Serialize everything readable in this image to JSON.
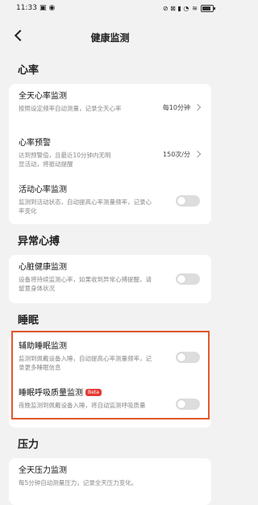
{
  "status": {
    "time": "11:33",
    "right_icons": "⊘ ⊠ ▮ ◔"
  },
  "header": {
    "title": "健康监测"
  },
  "sections": {
    "heart_rate": {
      "title": "心率",
      "all_day": {
        "title": "全天心率监测",
        "sub": "按照设定频率自动测量，记录全天心率",
        "value": "每10分钟"
      },
      "warning": {
        "title": "心率预警",
        "sub": "达到预警值，且最近10分钟内无明显活动，将振动提醒",
        "value": "150次/分"
      },
      "activity": {
        "title": "活动心率监测",
        "sub": "监测到活动状态，自动提高心率测量频率，记录心率变化"
      }
    },
    "abnormal": {
      "title": "异常心搏",
      "heart_health": {
        "title": "心脏健康监测",
        "sub": "设备将持续监测心率，如果收到异常心搏提醒，请留意身体状况"
      }
    },
    "sleep": {
      "title": "睡眠",
      "assist": {
        "title": "辅助睡眠监测",
        "sub": "监测到佩戴设备入睡，自动提高心率测量频率，记录更多睡眠信息"
      },
      "breathing": {
        "title": "睡眠呼吸质量监测",
        "badge": "Beta",
        "sub": "夜晚监测到佩戴设备入睡，将自动监测呼吸质量"
      }
    },
    "stress": {
      "title": "压力",
      "all_day": {
        "title": "全天压力监测",
        "sub": "每5分钟自动测量压力，记录全天压力变化。"
      }
    }
  }
}
